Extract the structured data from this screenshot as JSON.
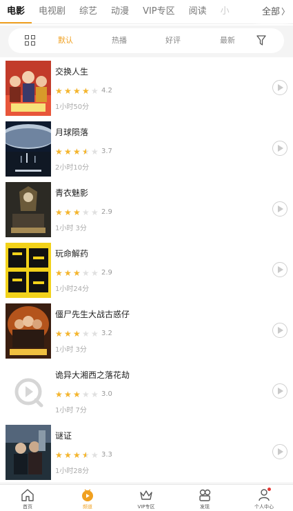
{
  "top_tabs": [
    "电影",
    "电视剧",
    "综艺",
    "动漫",
    "VIP专区",
    "阅读"
  ],
  "top_tabs_more": "全部",
  "filter": {
    "options": [
      "默认",
      "热播",
      "好评",
      "最新"
    ],
    "active": "默认"
  },
  "movies": [
    {
      "title": "交换人生",
      "rating": "4.2",
      "stars": 4.0,
      "duration": "1小时50分"
    },
    {
      "title": "月球陨落",
      "rating": "3.7",
      "stars": 3.5,
      "duration": "2小时10分"
    },
    {
      "title": "青衣魅影",
      "rating": "2.9",
      "stars": 3.0,
      "duration": "1小时 3分"
    },
    {
      "title": "玩命解药",
      "rating": "2.9",
      "stars": 3.0,
      "duration": "1小时24分"
    },
    {
      "title": "僵尸先生大战古惑仔",
      "rating": "3.2",
      "stars": 3.0,
      "duration": "1小时 3分"
    },
    {
      "title": "诡异大湘西之落花劫",
      "rating": "3.0",
      "stars": 3.0,
      "duration": "1小时 7分"
    },
    {
      "title": "谜证",
      "rating": "3.3",
      "stars": 3.5,
      "duration": "1小时28分"
    }
  ],
  "bottom_nav": [
    {
      "label": "首页"
    },
    {
      "label": "频道"
    },
    {
      "label": "VIP专区"
    },
    {
      "label": "发现"
    },
    {
      "label": "个人中心"
    }
  ],
  "colors": {
    "accent": "#f0a020",
    "star": "#f5b52b",
    "badge": "#e53935"
  }
}
